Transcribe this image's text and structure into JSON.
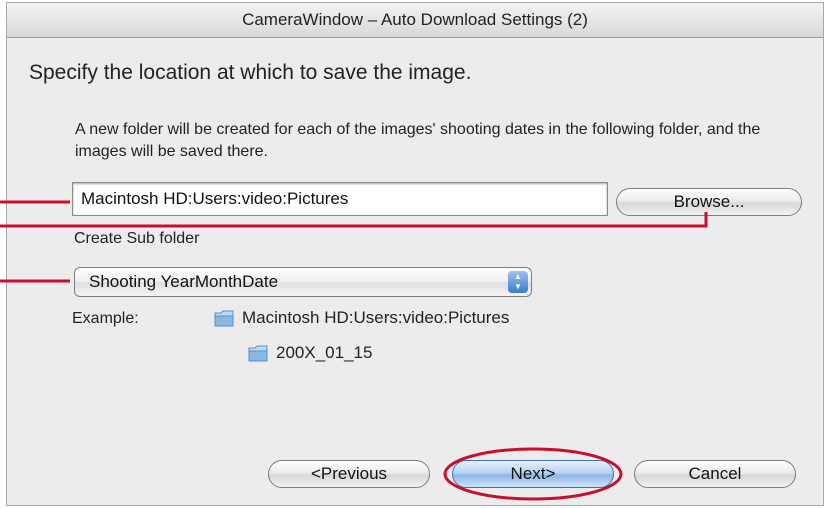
{
  "window": {
    "title": "CameraWindow – Auto Download Settings (2)"
  },
  "heading": "Specify the location at which to save the image.",
  "description": "A new folder will be created for each of the images' shooting dates in the following folder, and the images will be saved there.",
  "location": {
    "value": "Macintosh HD:Users:video:Pictures"
  },
  "browse_label": "Browse...",
  "subfolder": {
    "label": "Create Sub folder",
    "selected": "Shooting YearMonthDate"
  },
  "example": {
    "label": "Example:",
    "root": "Macintosh HD:Users:video:Pictures",
    "child": "200X_01_15"
  },
  "buttons": {
    "previous": "<Previous",
    "next": "Next>",
    "cancel": "Cancel"
  },
  "colors": {
    "callout": "#c8102e",
    "default_button": "#8eb8e6",
    "folder": "#8ab8e4"
  },
  "icons": {
    "folder": "folder-icon",
    "select_arrows": "up-down-arrows-icon"
  }
}
